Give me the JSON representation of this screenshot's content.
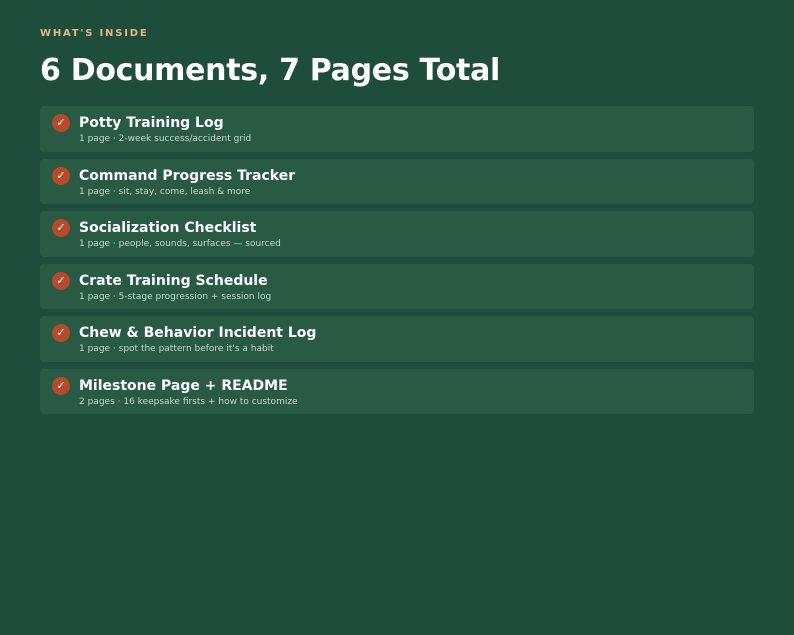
{
  "header": {
    "eyebrow": "WHAT'S INSIDE",
    "title": "6 Documents, 7 Pages Total"
  },
  "icons": {
    "check": "check-icon",
    "check_glyph": "✓"
  },
  "colors": {
    "background": "#1f4d3b",
    "card": "#285a44",
    "accent": "#b54a2c",
    "eyebrow": "#e0b98b"
  },
  "items": [
    {
      "title": "Potty Training Log",
      "subtitle": "1 page · 2-week success/accident grid"
    },
    {
      "title": "Command Progress Tracker",
      "subtitle": "1 page · sit, stay, come, leash & more"
    },
    {
      "title": "Socialization Checklist",
      "subtitle": "1 page · people, sounds, surfaces — sourced"
    },
    {
      "title": "Crate Training Schedule",
      "subtitle": "1 page · 5-stage progression + session log"
    },
    {
      "title": "Chew & Behavior Incident Log",
      "subtitle": "1 page · spot the pattern before it's a habit"
    },
    {
      "title": "Milestone Page + README",
      "subtitle": "2 pages · 16 keepsake firsts + how to customize"
    }
  ]
}
